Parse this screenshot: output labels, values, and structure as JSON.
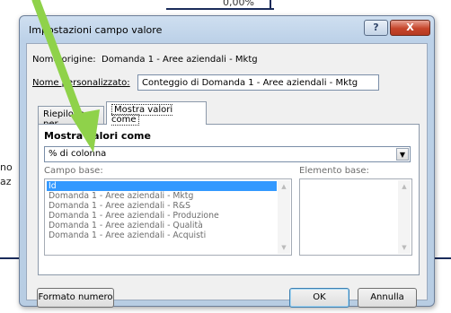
{
  "background": {
    "cell_value": "0,00%",
    "left_fragments": [
      "no",
      "az"
    ]
  },
  "dialog": {
    "title": "Impostazioni campo valore",
    "help_label": "?",
    "close_label": "X",
    "origin_label": "Nome origine:",
    "origin_value": "Domanda 1 - Aree aziendali - Mktg",
    "custom_name_label": "Nome personalizzato:",
    "custom_name_value": "Conteggio di Domanda 1 - Aree aziendali - Mktg",
    "tabs": [
      {
        "label": "Riepiloga per"
      },
      {
        "label": "Mostra valori come"
      }
    ],
    "group_title": "Mostra valori come",
    "show_as_value": "% di colonna",
    "base_field_label": "Campo base:",
    "base_item_label": "Elemento base:",
    "base_field_items": [
      "Id",
      "Domanda 1 - Aree aziendali - Mktg",
      "Domanda 1 - Aree aziendali - R&S",
      "Domanda 1 - Aree aziendali - Produzione",
      "Domanda 1 - Aree aziendali - Qualità",
      "Domanda 1 - Aree aziendali - Acquisti"
    ],
    "buttons": {
      "format": "Formato numero",
      "ok": "OK",
      "cancel": "Annulla"
    }
  },
  "colors": {
    "annotation_arrow": "#8fd24a",
    "selection": "#3399ff"
  }
}
